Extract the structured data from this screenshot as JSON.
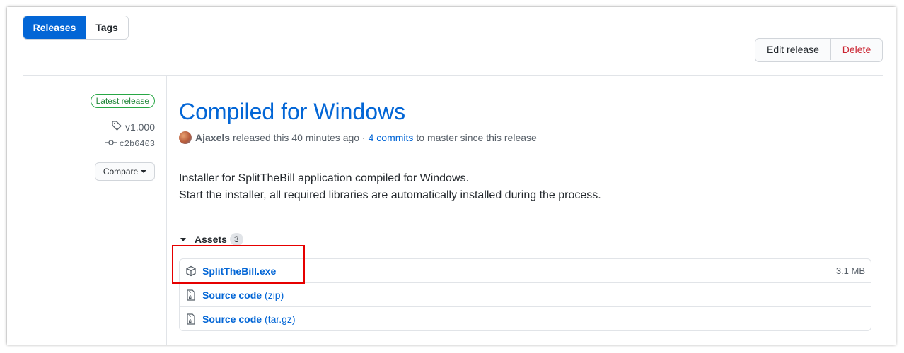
{
  "tabs": [
    {
      "label": "Releases",
      "active": true
    },
    {
      "label": "Tags",
      "active": false
    }
  ],
  "actions": {
    "edit_label": "Edit release",
    "delete_label": "Delete"
  },
  "sidebar": {
    "latest_badge": "Latest release",
    "tag": "v1.000",
    "commit": "c2b6403",
    "compare_label": "Compare"
  },
  "release": {
    "title": "Compiled for Windows",
    "author": "Ajaxels",
    "released_text": "released this 40 minutes ago ·",
    "commits_link": "4 commits",
    "commits_suffix": "to master since this release",
    "description": [
      "Installer for SplitTheBill application compiled for Windows.",
      "Start the installer, all required libraries are automatically installed during the process."
    ]
  },
  "assets": {
    "heading": "Assets",
    "count": "3",
    "items": [
      {
        "name": "SplitTheBill.exe",
        "ext": "",
        "size": "3.1 MB",
        "icon": "package-icon"
      },
      {
        "name": "Source code",
        "ext": "(zip)",
        "size": "",
        "icon": "file-zip-icon"
      },
      {
        "name": "Source code",
        "ext": "(tar.gz)",
        "size": "",
        "icon": "file-zip-icon"
      }
    ]
  },
  "colors": {
    "accent": "#0366d6",
    "danger": "#cb2431",
    "success": "#28a745",
    "highlight": "#e60000"
  }
}
